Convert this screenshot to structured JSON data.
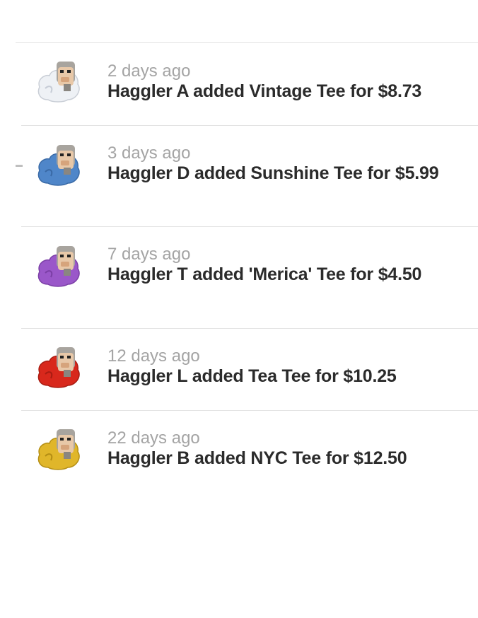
{
  "feed": {
    "items": [
      {
        "time": "2 days ago",
        "message": "Haggler A added Vintage Tee for $8.73",
        "avatar_color": "#e8ebf0",
        "avatar_icon": "haggler-avatar-icon"
      },
      {
        "time": "3 days ago",
        "message": "Haggler D added Sunshine Tee for $5.99",
        "avatar_color": "#4f86c9",
        "avatar_icon": "haggler-avatar-icon"
      },
      {
        "time": "7 days ago",
        "message": "Haggler T added 'Merica' Tee for $4.50",
        "avatar_color": "#9a57c9",
        "avatar_icon": "haggler-avatar-icon"
      },
      {
        "time": "12 days ago",
        "message": "Haggler L added Tea Tee for $10.25",
        "avatar_color": "#d8281c",
        "avatar_icon": "haggler-avatar-icon"
      },
      {
        "time": "22 days ago",
        "message": "Haggler B added NYC Tee for $12.50",
        "avatar_color": "#e0b62a",
        "avatar_icon": "haggler-avatar-icon"
      }
    ]
  }
}
